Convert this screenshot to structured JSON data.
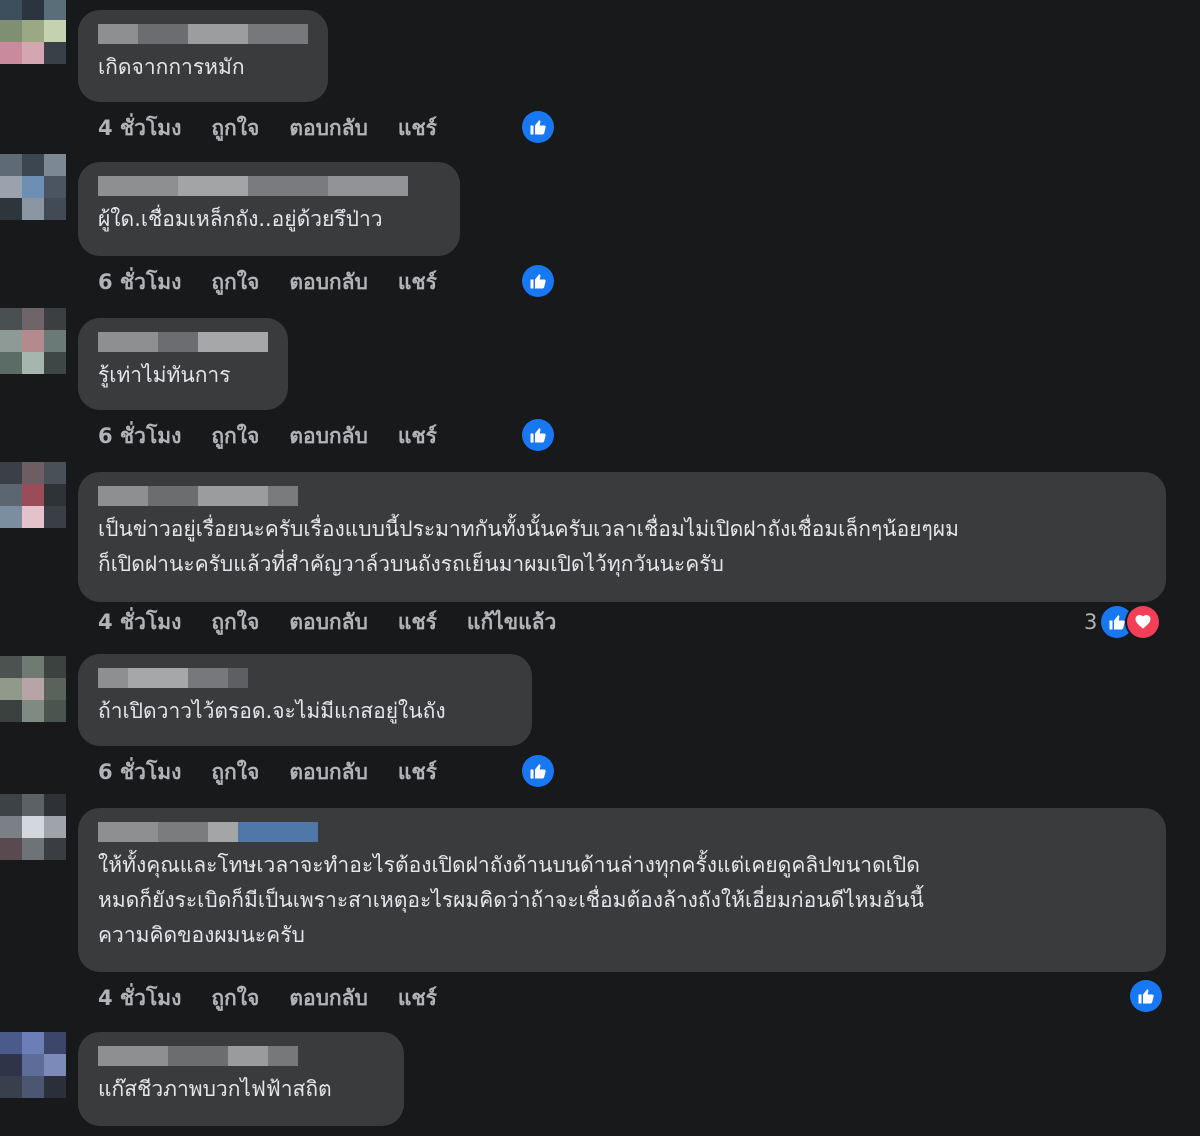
{
  "comments": [
    {
      "text": "เกิดจากการหมัก",
      "time": "4 ชั่วโมง",
      "like": "ถูกใจ",
      "reply": "ตอบกลับ",
      "share": "แชร์",
      "edited": "",
      "reaction_count": ""
    },
    {
      "text": "ผู้ใด.เชื่อมเหล็กถัง..อยู่ด้วยรึป่าว",
      "time": "6 ชั่วโมง",
      "like": "ถูกใจ",
      "reply": "ตอบกลับ",
      "share": "แชร์",
      "edited": "",
      "reaction_count": ""
    },
    {
      "text": "รู้เท่าไม่ทันการ",
      "time": "6 ชั่วโมง",
      "like": "ถูกใจ",
      "reply": "ตอบกลับ",
      "share": "แชร์",
      "edited": "",
      "reaction_count": ""
    },
    {
      "text": "เป็นข่าวอยู่เรื่อยนะครับเรื่องแบบนี้ประมาทกันทั้งนั้นครับเวลาเชื่อมไม่เปิดฝาถังเชื่อมเล็กๆน้อยๆผม\nก็เปิดฝานะครับแล้วที่สำคัญวาล์วบนถังรถเย็นมาผมเปิดไว้ทุกวันนะครับ",
      "time": "4 ชั่วโมง",
      "like": "ถูกใจ",
      "reply": "ตอบกลับ",
      "share": "แชร์",
      "edited": "แก้ไขแล้ว",
      "reaction_count": "3"
    },
    {
      "text": "ถ้าเปิดวาวไว้ตรอด.จะไม่มีแกสอยู่ในถัง",
      "time": "6 ชั่วโมง",
      "like": "ถูกใจ",
      "reply": "ตอบกลับ",
      "share": "แชร์",
      "edited": "",
      "reaction_count": ""
    },
    {
      "text": "ให้ทั้งคุณและโทษเวลาจะทำอะไรต้องเปิดฝาถังด้านบนด้านล่างทุกครั้งแต่เคยดูคลิปขนาดเปิด\nหมดก็ยังระเบิดก็มีเป็นเพราะสาเหตุอะไรผมคิดว่าถ้าจะเชื่อมต้องล้างถังให้เอี่ยมก่อนดีไหมอันนี้\nความคิดของผมนะครับ",
      "time": "4 ชั่วโมง",
      "like": "ถูกใจ",
      "reply": "ตอบกลับ",
      "share": "แชร์",
      "edited": "",
      "reaction_count": ""
    },
    {
      "text": "แก๊สชีวภาพบวกไฟฟ้าสถิต"
    }
  ],
  "colors": {
    "background": "#18191a",
    "bubble": "#3a3b3c",
    "like": "#1877f2",
    "love": "#f33e58",
    "secondary_text": "#b0b3b8"
  },
  "icons": [
    "thumbs-up-icon",
    "heart-icon"
  ]
}
